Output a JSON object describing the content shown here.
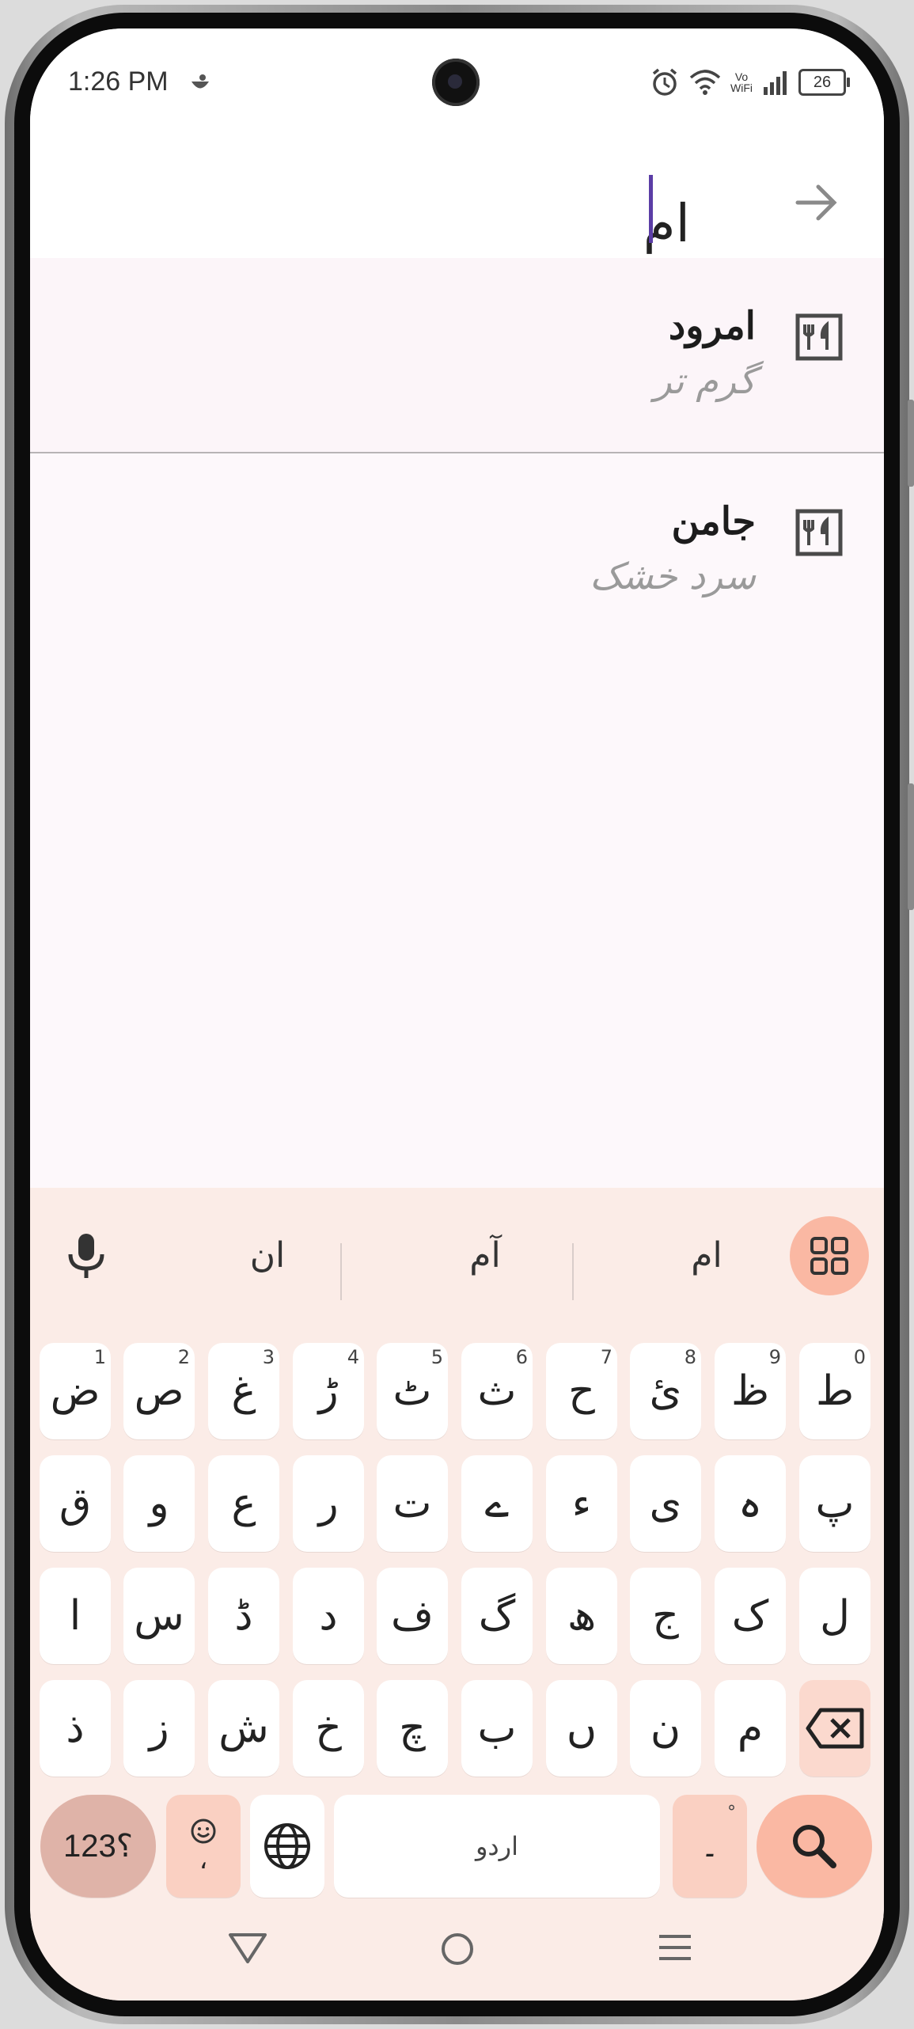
{
  "status_bar": {
    "time": "1:26 PM",
    "vowifi_top": "Vo",
    "vowifi_bottom": "WiFi",
    "battery": "26"
  },
  "search": {
    "query": "ام"
  },
  "results": [
    {
      "title": "امرود",
      "subtitle": "گرم تر",
      "icon": "restaurant-menu-icon"
    },
    {
      "title": "جامن",
      "subtitle": "سرد خشک",
      "icon": "restaurant-menu-icon"
    }
  ],
  "keyboard": {
    "suggestions": [
      "ام",
      "آم",
      "ان"
    ],
    "row1": [
      {
        "char": "ط",
        "num": "0"
      },
      {
        "char": "ظ",
        "num": "9"
      },
      {
        "char": "ئ",
        "num": "8"
      },
      {
        "char": "ح",
        "num": "7"
      },
      {
        "char": "ث",
        "num": "6"
      },
      {
        "char": "ٹ",
        "num": "5"
      },
      {
        "char": "ڑ",
        "num": "4"
      },
      {
        "char": "غ",
        "num": "3"
      },
      {
        "char": "ص",
        "num": "2"
      },
      {
        "char": "ض",
        "num": "1"
      }
    ],
    "row2": [
      "پ",
      "ہ",
      "ی",
      "ء",
      "ے",
      "ت",
      "ر",
      "ع",
      "و",
      "ق"
    ],
    "row3": [
      "ل",
      "ک",
      "ج",
      "ھ",
      "گ",
      "ف",
      "د",
      "ڈ",
      "س",
      "ا"
    ],
    "row4": [
      "م",
      "ن",
      "ں",
      "ب",
      "چ",
      "خ",
      "ش",
      "ز",
      "ذ"
    ],
    "n123_label": "؟123",
    "emoji_comma": "،",
    "space_label": "اردو",
    "dot_label": "۔"
  },
  "colors": {
    "accent": "#fab8a3",
    "keyboard_bg": "#fbece7",
    "cursor": "#5b3da6"
  }
}
